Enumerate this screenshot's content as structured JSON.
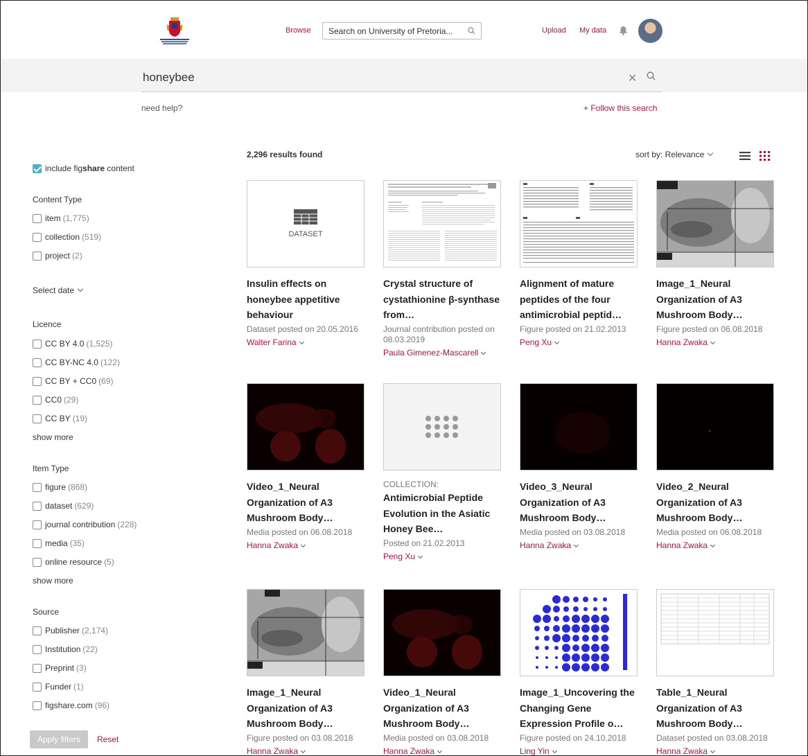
{
  "nav": {
    "browse": "Browse",
    "search_placeholder": "Search on University of Pretoria...",
    "upload": "Upload",
    "my_data": "My data"
  },
  "query": {
    "text": "honeybee",
    "need_help": "need help?",
    "follow": "+ Follow this search"
  },
  "sidebar": {
    "include_label_pre": "include fig",
    "include_label_bold": "share",
    "include_label_post": " content",
    "content_type": {
      "heading": "Content Type",
      "items": [
        {
          "label": "item",
          "count": "(1,775)"
        },
        {
          "label": "collection",
          "count": "(519)"
        },
        {
          "label": "project",
          "count": "(2)"
        }
      ]
    },
    "select_date": "Select date",
    "licence": {
      "heading": "Licence",
      "items": [
        {
          "label": "CC BY 4.0",
          "count": "(1,525)"
        },
        {
          "label": "CC BY-NC 4.0",
          "count": "(122)"
        },
        {
          "label": "CC BY + CC0",
          "count": "(69)"
        },
        {
          "label": "CC0",
          "count": "(29)"
        },
        {
          "label": "CC BY",
          "count": "(19)"
        }
      ],
      "show_more": "show more"
    },
    "item_type": {
      "heading": "Item Type",
      "items": [
        {
          "label": "figure",
          "count": "(868)"
        },
        {
          "label": "dataset",
          "count": "(629)"
        },
        {
          "label": "journal contribution",
          "count": "(228)"
        },
        {
          "label": "media",
          "count": "(35)"
        },
        {
          "label": "online resource",
          "count": "(5)"
        }
      ],
      "show_more": "show more"
    },
    "source": {
      "heading": "Source",
      "items": [
        {
          "label": "Publisher",
          "count": "(2,174)"
        },
        {
          "label": "Institution",
          "count": "(22)"
        },
        {
          "label": "Preprint",
          "count": "(3)"
        },
        {
          "label": "Funder",
          "count": "(1)"
        },
        {
          "label": "figshare.com",
          "count": "(96)"
        }
      ]
    },
    "apply": "Apply filters",
    "reset": "Reset"
  },
  "results": {
    "count": "2,296 results found",
    "sort": "sort by: Relevance"
  },
  "cards": [
    {
      "thumb": "DATASET",
      "title": "Insulin effects on honeybee appetitive behaviour",
      "meta": "Dataset posted on 20.05.2016",
      "author": "Walter Farina"
    },
    {
      "title": "Crystal structure of cystathionine β-synthase from…",
      "meta": "Journal contribution posted on 08.03.2019",
      "author": "Paula Gimenez-Mascarell"
    },
    {
      "title": "Alignment of mature peptides of the four antimicrobial peptid…",
      "meta": "Figure posted on 21.02.2013",
      "author": "Peng Xu"
    },
    {
      "title": "Image_1_Neural Organization of A3 Mushroom Body…",
      "meta": "Figure posted on 06.08.2018",
      "author": "Hanna Zwaka"
    },
    {
      "title": "Video_1_Neural Organization of A3 Mushroom Body…",
      "meta": "Media posted on 06.08.2018",
      "author": "Hanna Zwaka"
    },
    {
      "label": "COLLECTION:",
      "title": "Antimicrobial Peptide Evolution in the Asiatic Honey Bee…",
      "meta": "Posted on 21.02.2013",
      "author": "Peng Xu"
    },
    {
      "title": "Video_3_Neural Organization of A3 Mushroom Body…",
      "meta": "Media posted on 03.08.2018",
      "author": "Hanna Zwaka"
    },
    {
      "title": "Video_2_Neural Organization of A3 Mushroom Body…",
      "meta": "Media posted on 06.08.2018",
      "author": "Hanna Zwaka"
    },
    {
      "title": "Image_1_Neural Organization of A3 Mushroom Body…",
      "meta": "Figure posted on 03.08.2018",
      "author": "Hanna Zwaka"
    },
    {
      "title": "Video_1_Neural Organization of A3 Mushroom Body…",
      "meta": "Media posted on 03.08.2018",
      "author": "Hanna Zwaka"
    },
    {
      "title": "Image_1_Uncovering the Changing Gene Expression Profile o…",
      "meta": "Figure posted on 24.10.2018",
      "author": "Ling Yin"
    },
    {
      "title": "Table_1_Neural Organization of A3 Mushroom Body…",
      "meta": "Dataset posted on 03.08.2018",
      "author": "Hanna Zwaka"
    }
  ],
  "colors": {
    "accent": "#b0153f",
    "check": "#4bb3c3",
    "grid_icon": "#a01040"
  }
}
